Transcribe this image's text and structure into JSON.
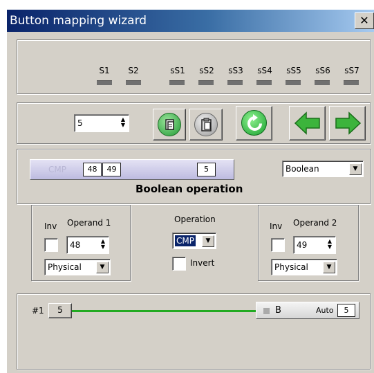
{
  "window": {
    "title": "Button mapping wizard",
    "close_label": "✕"
  },
  "slots": [
    "S1",
    "S2",
    "sS1",
    "sS2",
    "sS3",
    "sS4",
    "sS5",
    "sS6",
    "sS7"
  ],
  "toolbar": {
    "index_value": "5",
    "icons": [
      "copy-icon",
      "paste-icon",
      "reset-icon",
      "back-arrow-icon",
      "forward-arrow-icon"
    ]
  },
  "operation_bar": {
    "faded_label": "CMP",
    "operand1_value": "48",
    "operand2_value": "49",
    "result_value": "5",
    "type_select_value": "Boolean",
    "heading": "Boolean operation"
  },
  "operand1": {
    "inv_label": "Inv",
    "title": "Operand 1",
    "value": "48",
    "source_value": "Physical"
  },
  "operation": {
    "title": "Operation",
    "selected": "CMP",
    "invert_label": "Invert"
  },
  "operand2": {
    "inv_label": "Inv",
    "title": "Operand 2",
    "value": "49",
    "source_value": "Physical"
  },
  "mapping": {
    "index_label": "#1",
    "source_value": "5",
    "target_label": "B",
    "mode_label": "Auto",
    "target_value": "5",
    "line_color": "#22aa22"
  }
}
